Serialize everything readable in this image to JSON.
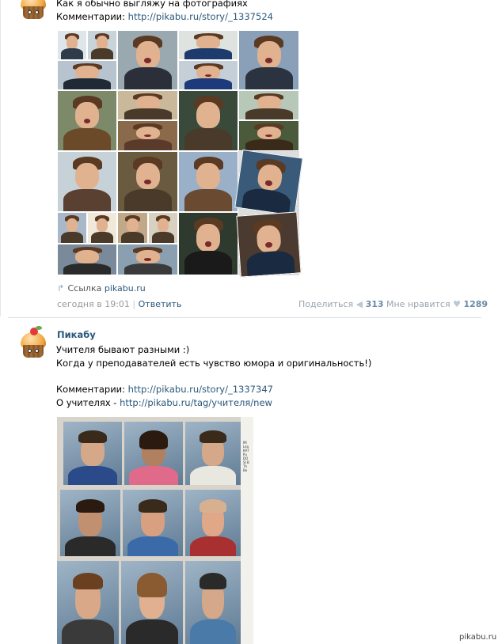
{
  "post1": {
    "caption": "Как я обычно выгляжу на фотографиях",
    "comments_label": "Комментарии:",
    "comments_url": "http://pikabu.ru/story/_1337524",
    "link_label": "Ссылка",
    "link_domain": "pikabu.ru",
    "time": "сегодня в 19:01",
    "sep": "|",
    "reply": "Ответить",
    "share_label": "Поделиться",
    "share_count": "313",
    "like_label": "Мне нравится",
    "like_count": "1289"
  },
  "post2": {
    "author": "Пикабу",
    "line1": "Учителя бывают разными :)",
    "line2": "Когда у преподавателей есть чувство юмора и оригинальность!)",
    "comments_label": "Комментарии:",
    "comments_url": "http://pikabu.ru/story/_1337347",
    "teachers_label": "О учителях -",
    "teachers_url": "http://pikabu.ru/tag/учителя/new",
    "page_edge_text": "MI Lea KAT Pu DO SI B Th Be"
  },
  "watermark": "pikabu.ru",
  "colors": {
    "link": "#2b587a",
    "meta": "#999999",
    "divider": "#dae1e8",
    "icon": "#b9c8d6"
  },
  "icons": {
    "avatar": "cupcake-avatar",
    "share": "megaphone-icon",
    "like": "heart-icon",
    "link": "share-arrow-icon"
  }
}
